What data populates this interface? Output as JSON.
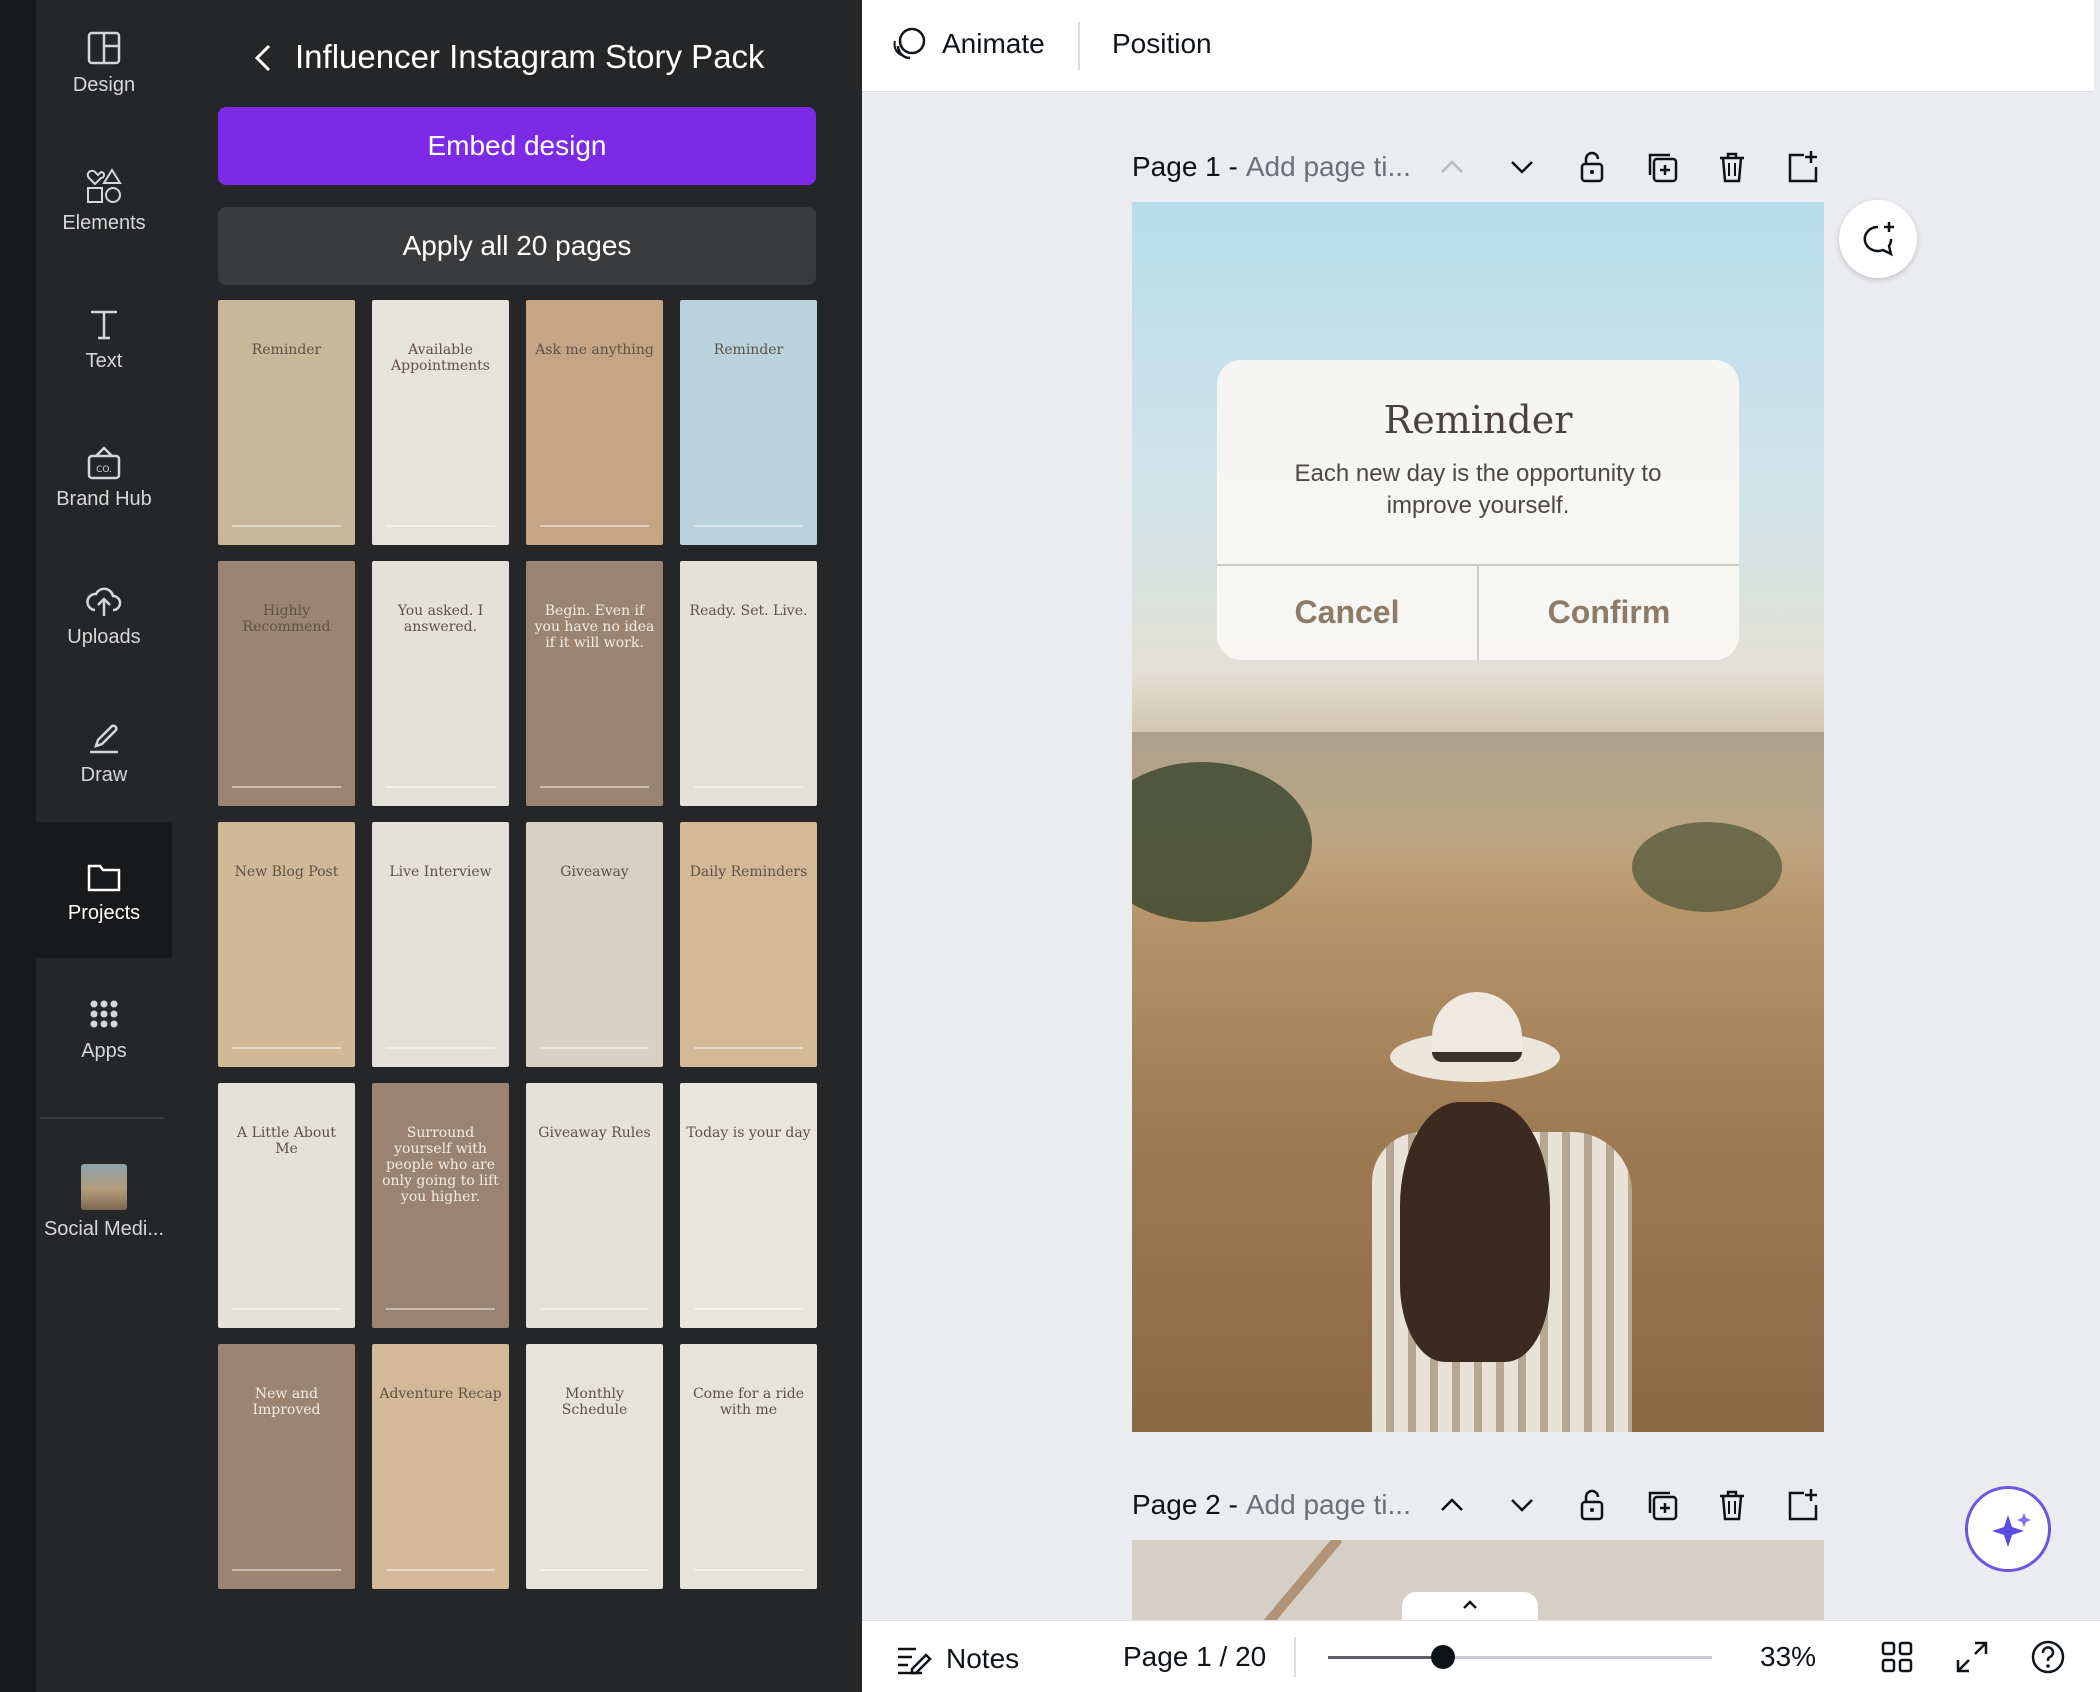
{
  "rail": {
    "items": [
      {
        "label": "Design",
        "icon": "layout-icon"
      },
      {
        "label": "Elements",
        "icon": "shapes-icon"
      },
      {
        "label": "Text",
        "icon": "text-icon"
      },
      {
        "label": "Brand Hub",
        "icon": "brand-hub-icon"
      },
      {
        "label": "Uploads",
        "icon": "cloud-upload-icon"
      },
      {
        "label": "Draw",
        "icon": "pen-icon"
      },
      {
        "label": "Projects",
        "icon": "folder-icon"
      },
      {
        "label": "Apps",
        "icon": "apps-grid-icon"
      },
      {
        "label": "Social Medi...",
        "icon": "project-thumbnail"
      }
    ],
    "active": "Projects"
  },
  "panel": {
    "title": "Influencer Instagram Story Pack",
    "embed_label": "Embed design",
    "apply_label": "Apply all 20 pages",
    "thumbnails": [
      {
        "text": "Reminder",
        "bg": "#c9b79c",
        "dark": false
      },
      {
        "text": "Available Appointments",
        "bg": "#e6e2dc",
        "dark": false
      },
      {
        "text": "Ask me anything",
        "bg": "#c4a584",
        "dark": false
      },
      {
        "text": "Reminder",
        "bg": "#b9d2dc",
        "dark": false
      },
      {
        "text": "Highly Recommend",
        "bg": "#9d8470",
        "dark": false
      },
      {
        "text": "You asked. I answered.",
        "bg": "#e4e0da",
        "dark": false
      },
      {
        "text": "Begin. Even if you have no idea if it will work.",
        "bg": "#9b8470",
        "dark": true
      },
      {
        "text": "Ready. Set. Live.",
        "bg": "#e4e0da",
        "dark": false
      },
      {
        "text": "New Blog Post",
        "bg": "#d1b896",
        "dark": false
      },
      {
        "text": "Live Interview",
        "bg": "#e4e0da",
        "dark": false
      },
      {
        "text": "Giveaway",
        "bg": "#d9cfc2",
        "dark": false
      },
      {
        "text": "Daily Reminders",
        "bg": "#d4b997",
        "dark": false
      },
      {
        "text": "A Little About Me",
        "bg": "#e4e0da",
        "dark": false
      },
      {
        "text": "Surround yourself with people who are only going to lift you higher.",
        "bg": "#9a8371",
        "dark": true
      },
      {
        "text": "Giveaway Rules",
        "bg": "#e4e0da",
        "dark": false
      },
      {
        "text": "Today is your day",
        "bg": "#e8e4de",
        "dark": false
      },
      {
        "text": "New and Improved",
        "bg": "#9b8470",
        "dark": true
      },
      {
        "text": "Adventure Recap",
        "bg": "#d3b997",
        "dark": false
      },
      {
        "text": "Monthly Schedule",
        "bg": "#e6e2dc",
        "dark": false
      },
      {
        "text": "Come for a ride with me",
        "bg": "#e6e2dc",
        "dark": false
      }
    ]
  },
  "toolbar": {
    "animate_label": "Animate",
    "position_label": "Position"
  },
  "pages": [
    {
      "label": "Page 1 -",
      "title_placeholder": "Add page ti..."
    },
    {
      "label": "Page 2 -",
      "title_placeholder": "Add page ti..."
    }
  ],
  "dialog": {
    "title": "Reminder",
    "text": "Each new day is the opportunity to improve yourself.",
    "cancel": "Cancel",
    "confirm": "Confirm"
  },
  "footer": {
    "notes_label": "Notes",
    "page_indicator": "Page 1 / 20",
    "zoom": "33%",
    "zoom_slider_fraction": 0.3
  },
  "colors": {
    "accent": "#7d2ae8",
    "rail_bg": "#18191b",
    "panel_bg": "#252627",
    "workspace_bg": "#ebecf0"
  }
}
